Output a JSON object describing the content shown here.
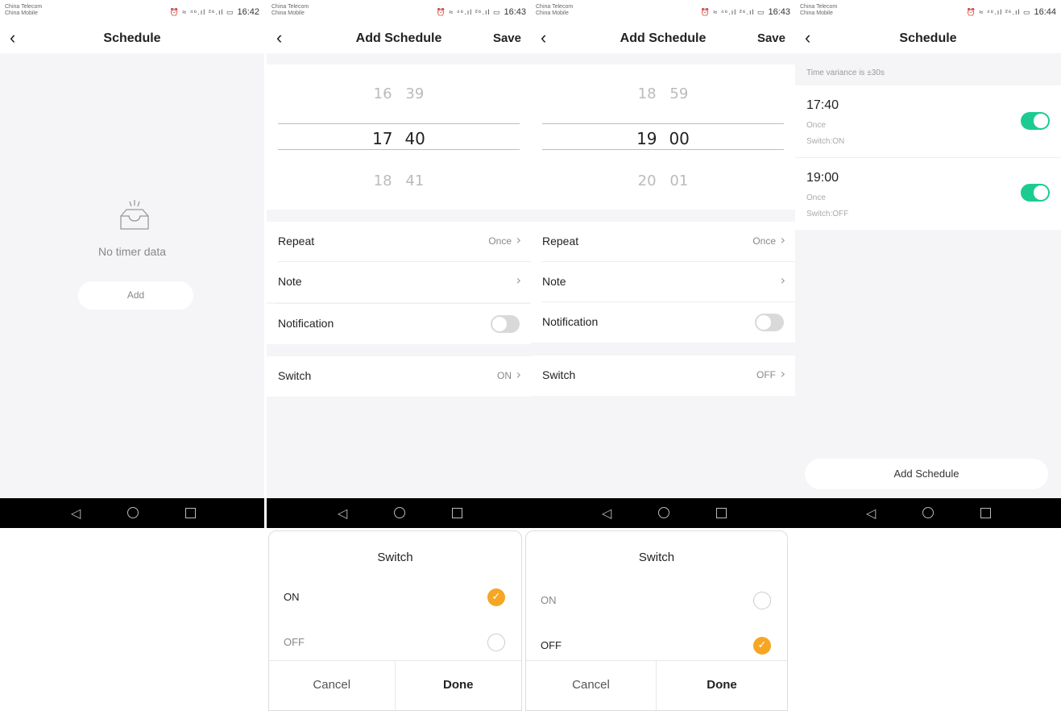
{
  "status": {
    "carrier1": "China Telecom",
    "carrier2": "China Mobile",
    "icons": "⏰ ≈ ⁴⁶.ıl ²⁶.ıl ▭"
  },
  "screen1": {
    "time": "16:42",
    "title": "Schedule",
    "empty_text": "No timer data",
    "add_label": "Add"
  },
  "screen2": {
    "time": "16:43",
    "title": "Add Schedule",
    "save": "Save",
    "picker": {
      "above": [
        "16",
        "39"
      ],
      "selected": [
        "17",
        "40"
      ],
      "below": [
        "18",
        "41"
      ]
    },
    "repeat_label": "Repeat",
    "repeat_value": "Once",
    "note_label": "Note",
    "notification_label": "Notification",
    "switch_label": "Switch",
    "switch_value": "ON"
  },
  "screen3": {
    "time": "16:43",
    "title": "Add Schedule",
    "save": "Save",
    "picker": {
      "above": [
        "18",
        "59"
      ],
      "selected": [
        "19",
        "00"
      ],
      "below": [
        "20",
        "01"
      ]
    },
    "repeat_label": "Repeat",
    "repeat_value": "Once",
    "note_label": "Note",
    "notification_label": "Notification",
    "switch_label": "Switch",
    "switch_value": "OFF"
  },
  "screen4": {
    "time": "16:44",
    "title": "Schedule",
    "variance": "Time variance is ±30s",
    "items": [
      {
        "time": "17:40",
        "repeat": "Once",
        "switch": "Switch:ON",
        "enabled": true
      },
      {
        "time": "19:00",
        "repeat": "Once",
        "switch": "Switch:OFF",
        "enabled": true
      }
    ],
    "add_label": "Add Schedule"
  },
  "dialog1": {
    "title": "Switch",
    "options": [
      "ON",
      "OFF"
    ],
    "selected": "ON",
    "cancel": "Cancel",
    "done": "Done"
  },
  "dialog2": {
    "title": "Switch",
    "options": [
      "ON",
      "OFF"
    ],
    "selected": "OFF",
    "cancel": "Cancel",
    "done": "Done"
  },
  "colors": {
    "toggle_on": "#1ccb91",
    "radio_selected": "#f5a623",
    "background": "#f5f5f7"
  },
  "icons": {
    "back": "back-chevron-icon",
    "empty": "empty-inbox-icon",
    "nav": [
      "triangle-back-icon",
      "circle-home-icon",
      "square-recent-icon"
    ]
  }
}
